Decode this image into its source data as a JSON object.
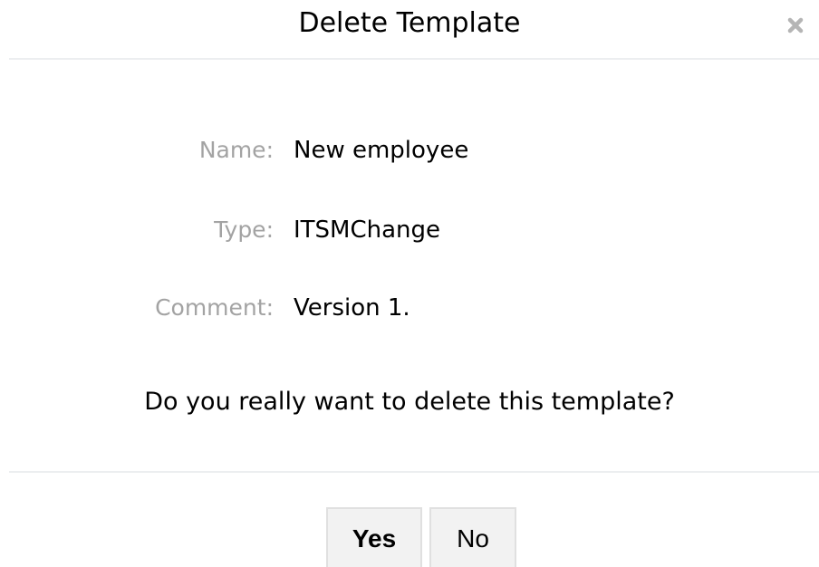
{
  "dialog": {
    "title": "Delete Template",
    "close_icon": "close-icon"
  },
  "fields": {
    "name": {
      "label": "Name:",
      "value": "New employee"
    },
    "type": {
      "label": "Type:",
      "value": "ITSMChange"
    },
    "comment": {
      "label": "Comment:",
      "value": "Version 1."
    }
  },
  "question": "Do you really want to delete this template?",
  "buttons": {
    "yes": "Yes",
    "no": "No"
  }
}
